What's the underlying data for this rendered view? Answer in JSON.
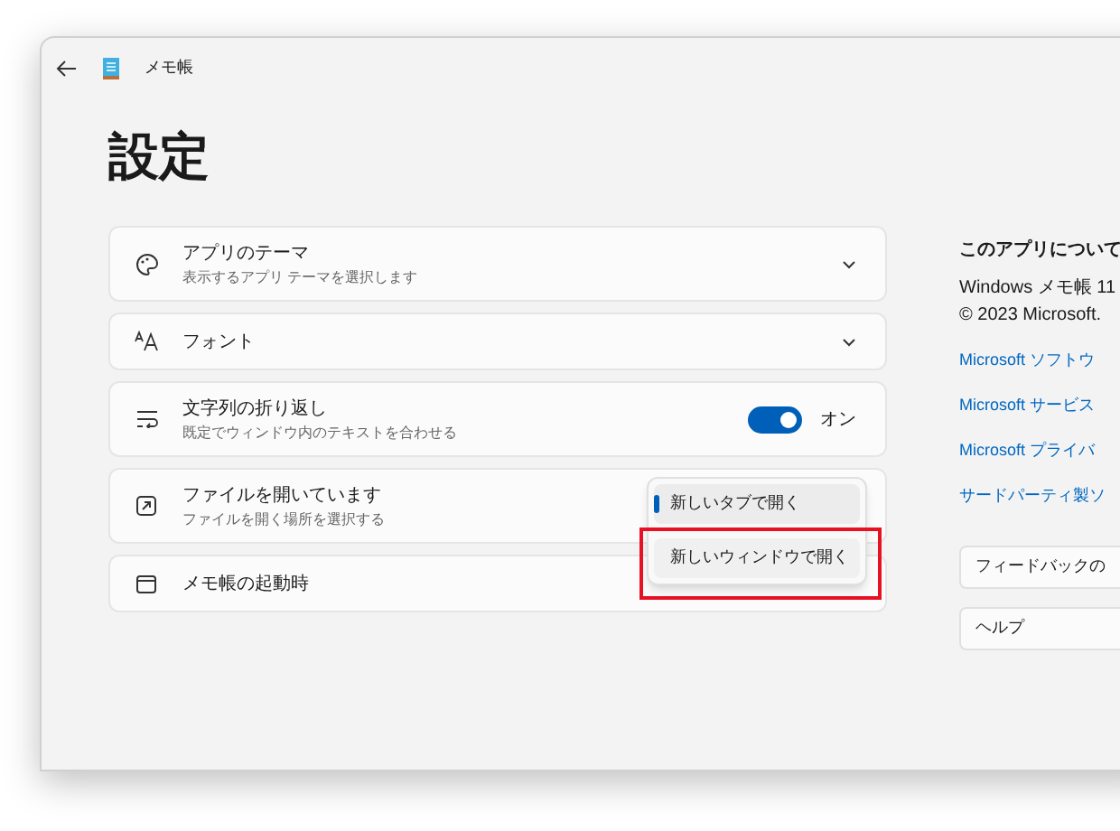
{
  "window": {
    "title": "メモ帳"
  },
  "page_title": "設定",
  "settings": [
    {
      "kind": "expander",
      "label": "アプリのテーマ",
      "description": "表示するアプリ テーマを選択します"
    },
    {
      "kind": "expander",
      "label": "フォント"
    },
    {
      "kind": "toggle",
      "label": "文字列の折り返し",
      "description": "既定でウィンドウ内のテキストを合わせる",
      "on": true,
      "state_label": "オン"
    },
    {
      "kind": "dropdown",
      "label": "ファイルを開いています",
      "description": "ファイルを開く場所を選択する",
      "options": [
        {
          "label": "新しいタブで開く",
          "selected": true,
          "highlighted": false
        },
        {
          "label": "新しいウィンドウで開く",
          "selected": false,
          "highlighted": true
        }
      ]
    },
    {
      "kind": "plain",
      "label": "メモ帳の起動時"
    }
  ],
  "about": {
    "heading": "このアプリについて",
    "lines": [
      "Windows メモ帳 11",
      "© 2023 Microsoft."
    ],
    "links": [
      "Microsoft ソフトウ",
      "Microsoft サービス",
      "Microsoft プライバ",
      "サードパーティ製ソ"
    ],
    "buttons": [
      "フィードバックの",
      "ヘルプ"
    ]
  }
}
